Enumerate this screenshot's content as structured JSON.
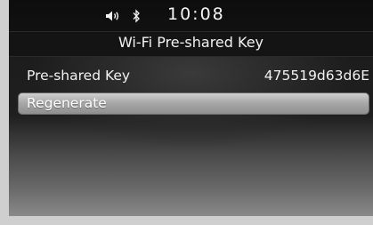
{
  "status_bar": {
    "icons": [
      "volume-icon",
      "bluetooth-icon"
    ],
    "time": "10:08"
  },
  "header": {
    "title": "Wi-Fi Pre-shared Key"
  },
  "settings": {
    "pre_shared_key": {
      "label": "Pre-shared Key",
      "value": "475519d63d6E"
    },
    "regenerate_label": "Regenerate"
  },
  "colors": {
    "screen_bg": "#1a1a1a",
    "text": "#f2f2f2",
    "button_highlight": "#a9a9a9"
  }
}
